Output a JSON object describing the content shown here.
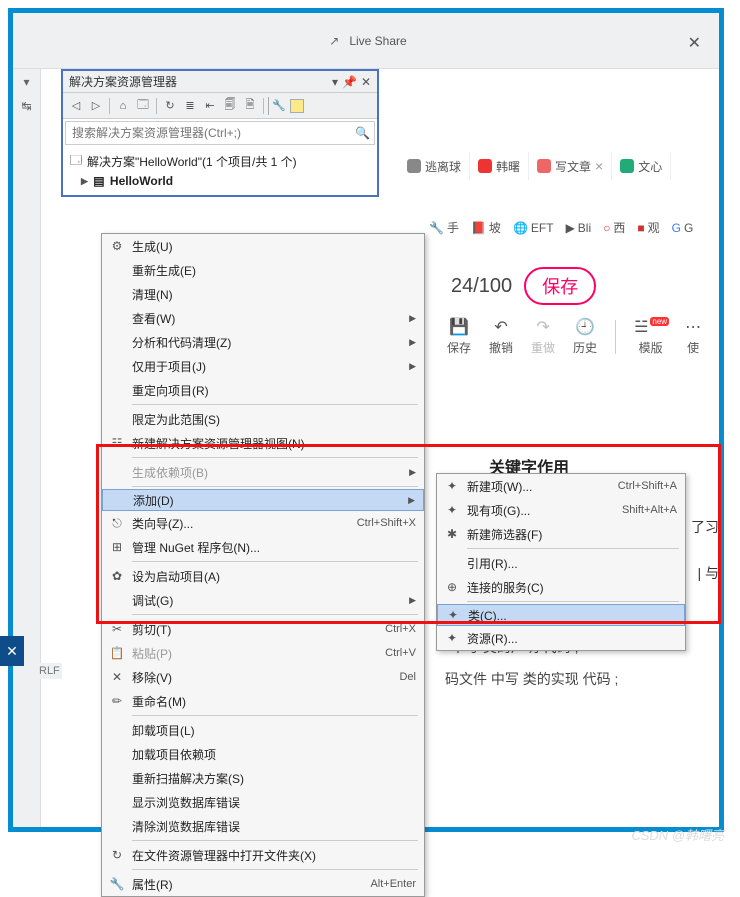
{
  "top": {
    "live_share": "Live Share",
    "close_glyph": "✕"
  },
  "solution_explorer": {
    "title": "解决方案资源管理器",
    "title_icons": [
      "▾",
      "⚀",
      "✕"
    ],
    "toolbar_icons": [
      "back",
      "fwd",
      "home",
      "refresh",
      "sync",
      "nest",
      "collapse",
      "copy",
      "showall",
      "wrench",
      "mark"
    ],
    "search_placeholder": "搜索解决方案资源管理器(Ctrl+;)",
    "search_icon": "🔍",
    "solution_label": "解决方案\"HelloWorld\"(1 个项目/共 1 个)",
    "project_label": "HelloWorld"
  },
  "context_menu": {
    "items": [
      {
        "icon": "⚙",
        "label": "生成(U)"
      },
      {
        "label": "重新生成(E)"
      },
      {
        "label": "清理(N)"
      },
      {
        "label": "查看(W)",
        "sub": true
      },
      {
        "label": "分析和代码清理(Z)",
        "sub": true
      },
      {
        "label": "仅用于项目(J)",
        "sub": true
      },
      {
        "label": "重定向项目(R)"
      },
      {
        "sep": true
      },
      {
        "label": "限定为此范围(S)"
      },
      {
        "icon": "☷",
        "label": "新建解决方案资源管理器视图(N)"
      },
      {
        "sep": true
      },
      {
        "label": "生成依赖项(B)",
        "sub": true,
        "disabled": true
      },
      {
        "sep": true
      },
      {
        "label": "添加(D)",
        "sub": true,
        "hl": true
      },
      {
        "icon": "⎋",
        "label": "类向导(Z)...",
        "short": "Ctrl+Shift+X"
      },
      {
        "icon": "⊞",
        "label": "管理 NuGet 程序包(N)..."
      },
      {
        "sep": true
      },
      {
        "icon": "✿",
        "label": "设为启动项目(A)"
      },
      {
        "label": "调试(G)",
        "sub": true
      },
      {
        "sep": true
      },
      {
        "icon": "✂",
        "label": "剪切(T)",
        "short": "Ctrl+X"
      },
      {
        "icon": "📋",
        "label": "粘贴(P)",
        "short": "Ctrl+V",
        "disabled": true
      },
      {
        "icon": "✕",
        "label": "移除(V)",
        "short": "Del"
      },
      {
        "icon": "✏",
        "label": "重命名(M)"
      },
      {
        "sep": true
      },
      {
        "label": "卸载项目(L)"
      },
      {
        "label": "加载项目依赖项"
      },
      {
        "label": "重新扫描解决方案(S)"
      },
      {
        "label": "显示浏览数据库错误"
      },
      {
        "label": "清除浏览数据库错误"
      },
      {
        "sep": true
      },
      {
        "icon": "↻",
        "label": "在文件资源管理器中打开文件夹(X)"
      },
      {
        "sep": true
      },
      {
        "icon": "🔧",
        "label": "属性(R)",
        "short": "Alt+Enter"
      }
    ]
  },
  "submenu": {
    "header": "关键字作用",
    "items": [
      {
        "icon": "✦",
        "label": "新建项(W)...",
        "short": "Ctrl+Shift+A"
      },
      {
        "icon": "✦",
        "label": "现有项(G)...",
        "short": "Shift+Alt+A"
      },
      {
        "icon": "✱",
        "label": "新建筛选器(F)"
      },
      {
        "sep": true
      },
      {
        "label": "引用(R)..."
      },
      {
        "icon": "⊕",
        "label": "连接的服务(C)"
      },
      {
        "sep": true
      },
      {
        "icon": "✦",
        "label": "类(C)...",
        "hl": true
      },
      {
        "icon": "✦",
        "label": "资源(R)..."
      }
    ]
  },
  "browser": {
    "tabs": [
      {
        "color": "#888",
        "label": "逃离球"
      },
      {
        "color": "#e33",
        "label": "韩曙"
      },
      {
        "color": "#e66",
        "label": "写文章",
        "close": true
      },
      {
        "color": "#2a7",
        "label": "文心"
      }
    ],
    "fav": [
      {
        "glyph": "🔧",
        "label": "手"
      },
      {
        "glyph": "📕",
        "label": "坡"
      },
      {
        "glyph": "🌐",
        "label": "EFT"
      },
      {
        "glyph": "▶",
        "label": "Bli"
      },
      {
        "glyph": "○",
        "label": "西",
        "color": "#e33"
      },
      {
        "glyph": "■",
        "label": "观",
        "color": "#c33"
      },
      {
        "glyph": "G",
        "label": "G",
        "color": "#3a7cf0"
      }
    ],
    "counter": "24/100",
    "save": "保存",
    "tools": [
      {
        "glyph": "💾",
        "label": "保存"
      },
      {
        "glyph": "↶",
        "label": "撤销"
      },
      {
        "glyph": "↷",
        "label": "重做",
        "disabled": true
      },
      {
        "glyph": "🕘",
        "label": "历史"
      },
      {
        "glyph": "☱",
        "label": "模版",
        "new": true
      },
      {
        "glyph": "⋯",
        "label": "使"
      }
    ]
  },
  "text": {
    "decl1": "中写 类的声明 代码 ;",
    "decl2": "码文件 中写 类的实现 代码 ;",
    "side1": "了习",
    "side2": "| 与"
  },
  "crlf": "RLF",
  "watermark": "CSDN @韩曙亮"
}
